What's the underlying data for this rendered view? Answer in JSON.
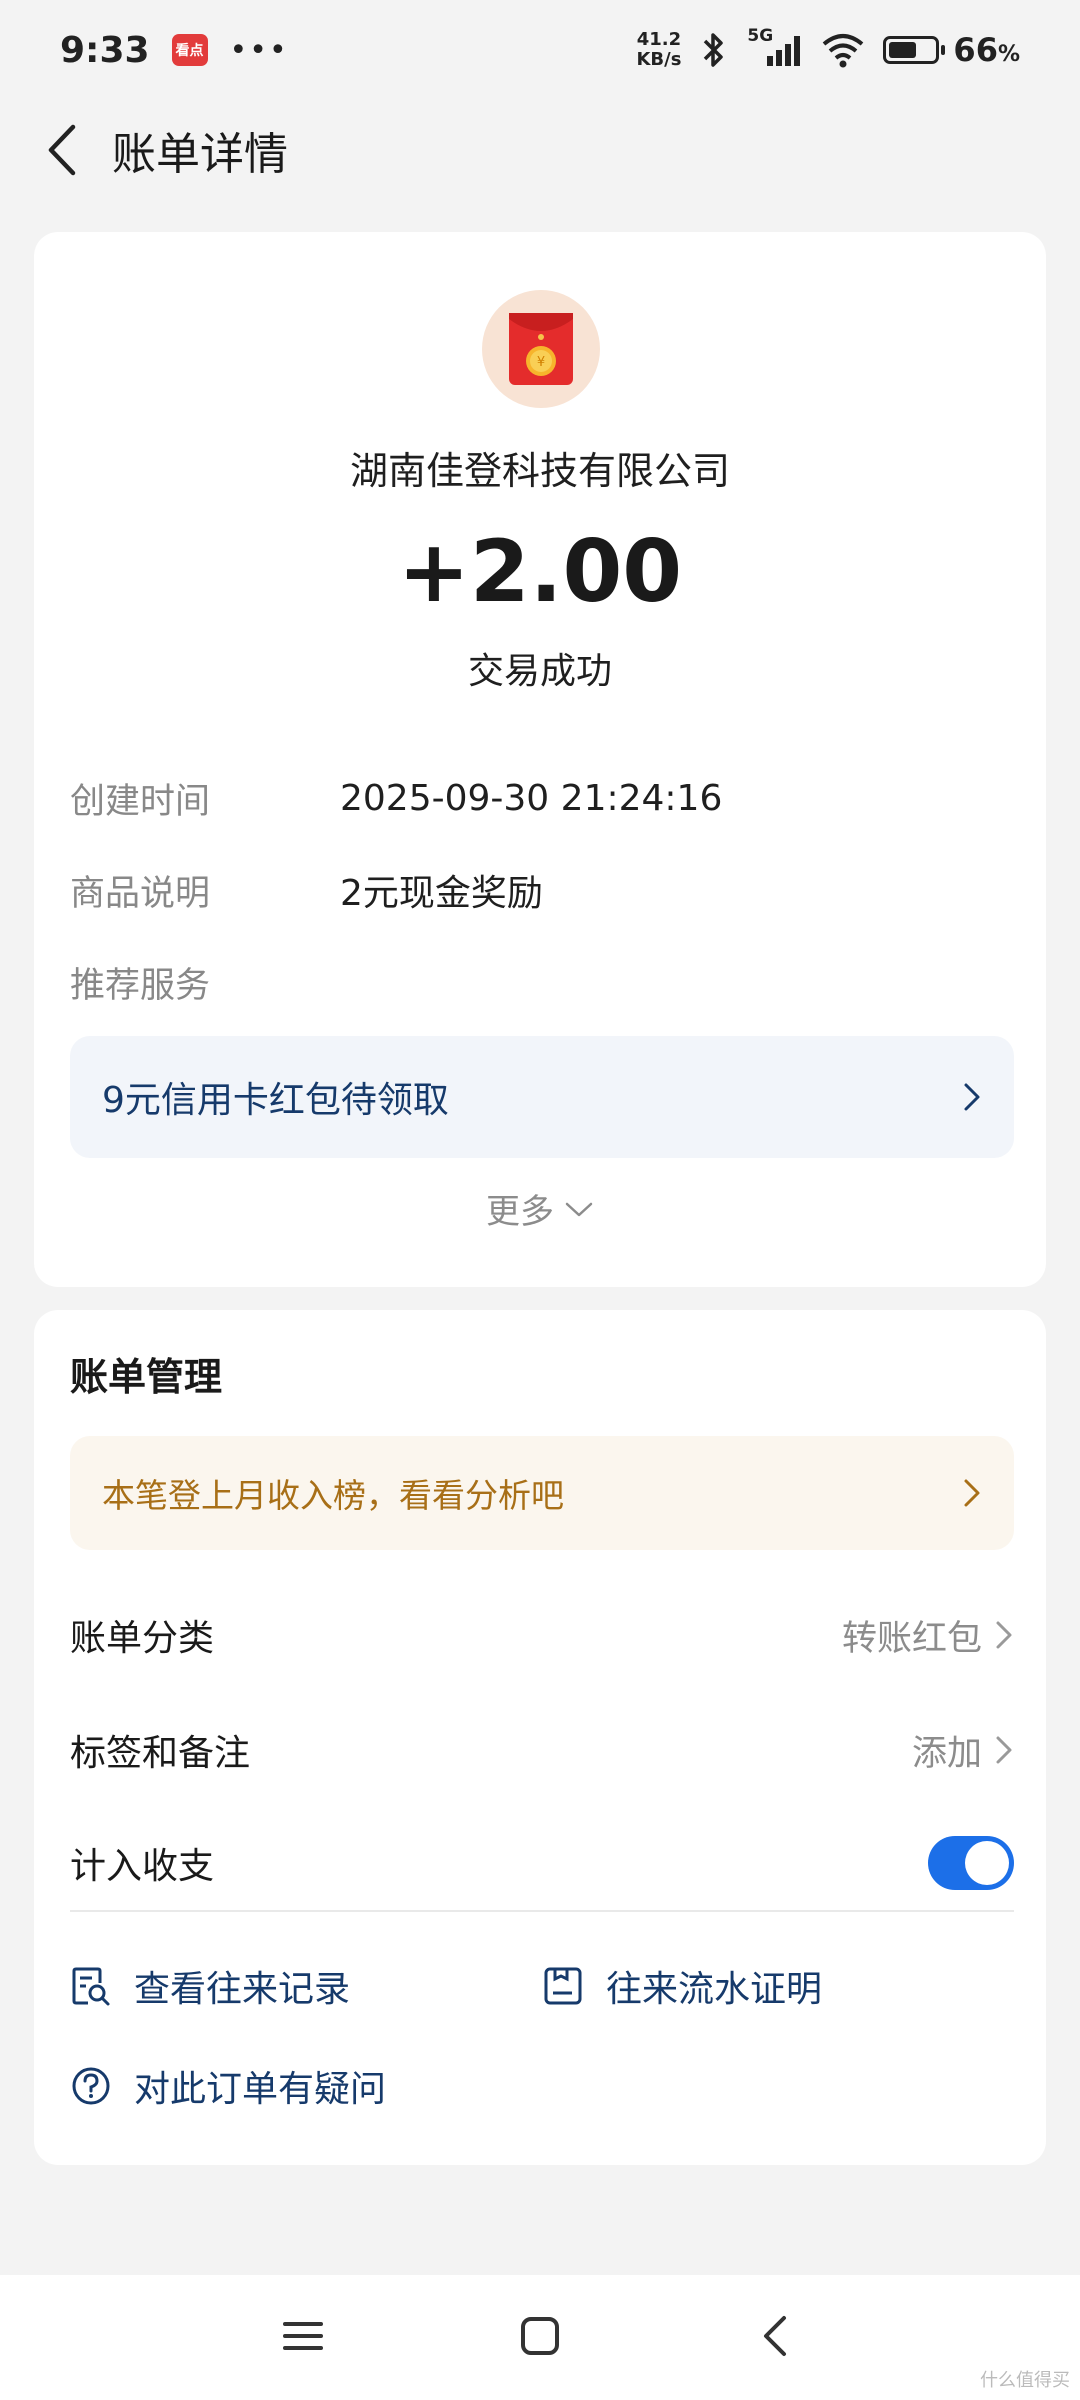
{
  "status_bar": {
    "time": "9:33",
    "app_icon_text": "看点",
    "dots": "•••",
    "net_speed_value": "41.2",
    "net_speed_unit": "KB/s",
    "network": "5G",
    "battery_pct": "66",
    "battery_unit": "%"
  },
  "header": {
    "title": "账单详情"
  },
  "detail": {
    "merchant": "湖南佳登科技有限公司",
    "amount": "+2.00",
    "status": "交易成功",
    "rows": [
      {
        "label": "创建时间",
        "value": "2025-09-30 21:24:16"
      },
      {
        "label": "商品说明",
        "value": "2元现金奖励"
      },
      {
        "label": "推荐服务",
        "value": ""
      }
    ],
    "promo": "9元信用卡红包待领取",
    "more": "更多"
  },
  "manage": {
    "title": "账单管理",
    "insight": "本笔登上月收入榜，看看分析吧",
    "category_label": "账单分类",
    "category_value": "转账红包",
    "tag_label": "标签和备注",
    "tag_value": "添加",
    "include_label": "计入收支",
    "include_on": true,
    "link_records": "查看往来记录",
    "link_proof": "往来流水证明",
    "link_question": "对此订单有疑问"
  },
  "colors": {
    "accent": "#1c6fe8",
    "link": "#163a6b",
    "insight": "#a86f17"
  },
  "watermark": "什么值得买"
}
